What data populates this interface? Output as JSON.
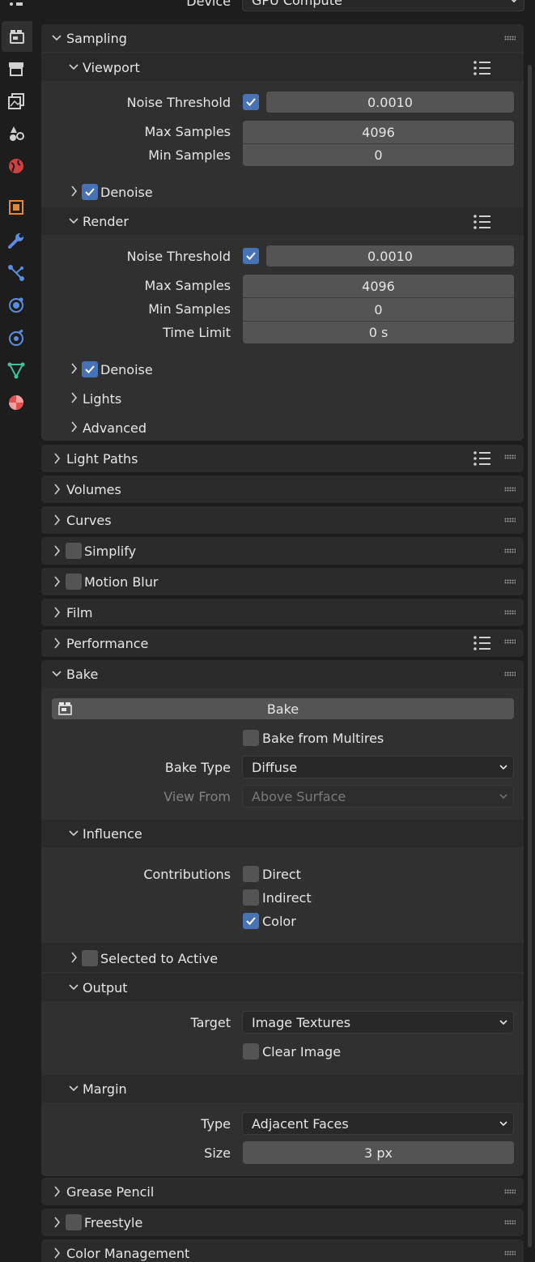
{
  "top": {
    "device_label": "Device",
    "device_value": "GPU Compute"
  },
  "sidebar": {
    "tabs": [
      {
        "icon": "render-icon",
        "color": "#d0d0d0",
        "active": true
      },
      {
        "icon": "output-icon",
        "color": "#d0d0d0"
      },
      {
        "icon": "view-layer-icon",
        "color": "#d0d0d0"
      },
      {
        "icon": "scene-icon",
        "color": "#d0d0d0"
      },
      {
        "icon": "world-icon",
        "color": "#d04040"
      },
      {
        "icon": "object-icon",
        "color": "#e08a3a"
      },
      {
        "icon": "modifier-icon",
        "color": "#5a8ee0"
      },
      {
        "icon": "particles-icon",
        "color": "#5a8ee0"
      },
      {
        "icon": "physics-icon",
        "color": "#5a8ee0"
      },
      {
        "icon": "constraints-icon",
        "color": "#5a8ee0"
      },
      {
        "icon": "data-icon",
        "color": "#3fc19e"
      },
      {
        "icon": "material-icon",
        "color": "#e05050"
      }
    ]
  },
  "sampling": {
    "title": "Sampling",
    "viewport": {
      "title": "Viewport",
      "noise_threshold_label": "Noise Threshold",
      "noise_threshold_value": "0.0010",
      "max_samples_label": "Max Samples",
      "max_samples_value": "4096",
      "min_samples_label": "Min Samples",
      "min_samples_value": "0",
      "denoise_label": "Denoise"
    },
    "render": {
      "title": "Render",
      "noise_threshold_label": "Noise Threshold",
      "noise_threshold_value": "0.0010",
      "max_samples_label": "Max Samples",
      "max_samples_value": "4096",
      "min_samples_label": "Min Samples",
      "min_samples_value": "0",
      "time_limit_label": "Time Limit",
      "time_limit_value": "0 s",
      "denoise_label": "Denoise"
    },
    "lights_label": "Lights",
    "advanced_label": "Advanced"
  },
  "panels": {
    "light_paths": "Light Paths",
    "volumes": "Volumes",
    "curves": "Curves",
    "simplify": "Simplify",
    "motion_blur": "Motion Blur",
    "film": "Film",
    "performance": "Performance",
    "grease_pencil": "Grease Pencil",
    "freestyle": "Freestyle",
    "color_management": "Color Management"
  },
  "bake": {
    "title": "Bake",
    "button_label": "Bake",
    "from_multires_label": "Bake from Multires",
    "bake_type_label": "Bake Type",
    "bake_type_value": "Diffuse",
    "view_from_label": "View From",
    "view_from_value": "Above Surface",
    "influence": {
      "title": "Influence",
      "contributions_label": "Contributions",
      "direct_label": "Direct",
      "indirect_label": "Indirect",
      "color_label": "Color"
    },
    "selected_to_active_label": "Selected to Active",
    "output": {
      "title": "Output",
      "target_label": "Target",
      "target_value": "Image Textures",
      "clear_image_label": "Clear Image"
    },
    "margin": {
      "title": "Margin",
      "type_label": "Type",
      "type_value": "Adjacent Faces",
      "size_label": "Size",
      "size_value": "3 px"
    }
  }
}
